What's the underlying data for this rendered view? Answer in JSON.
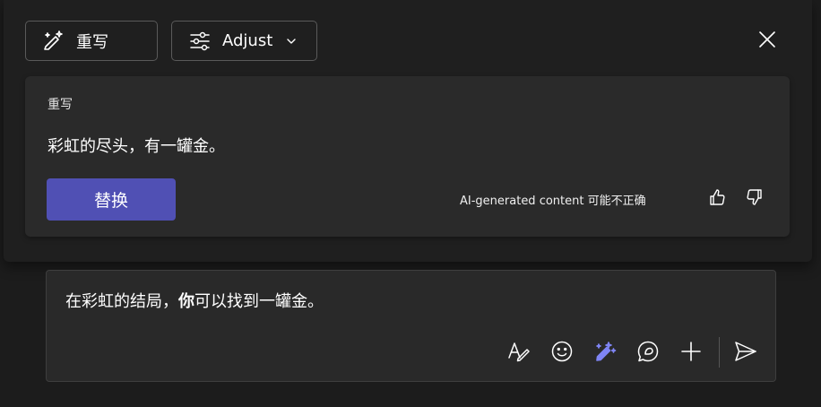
{
  "toolbar": {
    "rewrite_label": "重写",
    "adjust_label": "Adjust"
  },
  "suggestion": {
    "title": "重写",
    "text": "彩虹的尽头，有一罐金。",
    "replace_label": "替换",
    "disclaimer": "AI-generated content 可能不正确"
  },
  "compose": {
    "text_before": "在彩虹的结局，",
    "text_bold": "你",
    "text_after": "可以找到一罐金。"
  },
  "icons": {
    "rewrite": "pen-sparkle-icon",
    "adjust": "sliders-icon",
    "chevron": "chevron-down-icon",
    "close": "close-icon",
    "thumb_up": "thumbs-up-icon",
    "thumb_down": "thumbs-down-icon",
    "format": "format-text-icon",
    "emoji": "emoji-icon",
    "copilot": "copilot-rewrite-icon",
    "loop": "loop-icon",
    "add": "plus-icon",
    "send": "send-icon"
  },
  "colors": {
    "accent": "#5050b4",
    "copilot_icon": "#7f85f5",
    "background": "#1c1c1c",
    "card": "#2a2a2a"
  }
}
